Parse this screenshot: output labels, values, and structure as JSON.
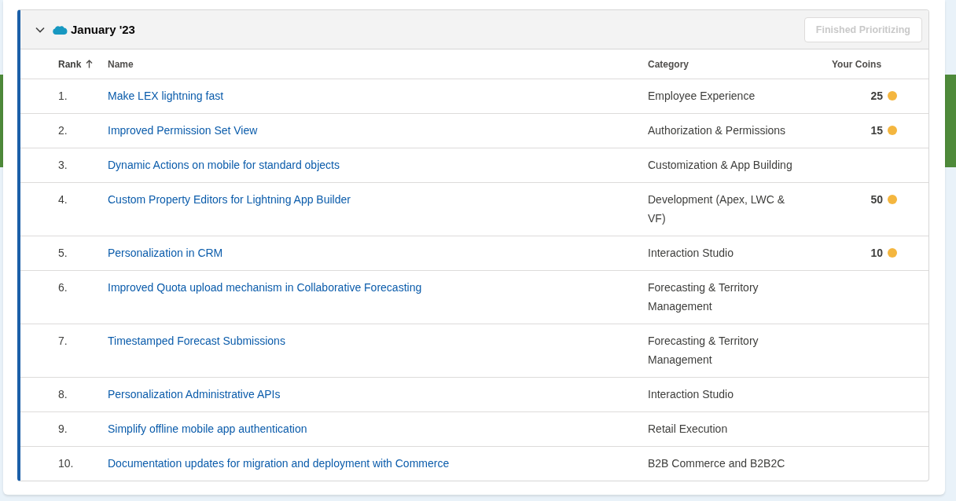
{
  "section": {
    "title": "January '23",
    "expanded": true,
    "button": {
      "label": "Finished Prioritizing",
      "disabled": true
    }
  },
  "table": {
    "columns": [
      {
        "label": "Rank",
        "sorted": true
      },
      {
        "label": "Name",
        "sorted": false
      },
      {
        "label": "Category",
        "sorted": false
      },
      {
        "label": "Your Coins",
        "sorted": false
      }
    ],
    "rows": [
      {
        "rank": "1.",
        "name": "Make LEX lightning fast",
        "category": "Employee Experience",
        "coins": "25"
      },
      {
        "rank": "2.",
        "name": "Improved Permission Set View",
        "category": "Authorization & Permissions",
        "coins": "15"
      },
      {
        "rank": "3.",
        "name": "Dynamic Actions on mobile for standard objects",
        "category": "Customization & App Building"
      },
      {
        "rank": "4.",
        "name": "Custom Property Editors for Lightning App Builder",
        "category": "Development (Apex, LWC & VF)",
        "coins": "50"
      },
      {
        "rank": "5.",
        "name": "Personalization in CRM",
        "category": "Interaction Studio",
        "coins": "10"
      },
      {
        "rank": "6.",
        "name": "Improved Quota upload mechanism in Collaborative Forecasting",
        "category": "Forecasting & Territory Management"
      },
      {
        "rank": "7.",
        "name": "Timestamped Forecast Submissions",
        "category": "Forecasting & Territory Management"
      },
      {
        "rank": "8.",
        "name": "Personalization Administrative APIs",
        "category": "Interaction Studio"
      },
      {
        "rank": "9.",
        "name": "Simplify offline mobile app authentication",
        "category": "Retail Execution"
      },
      {
        "rank": "10.",
        "name": "Documentation updates for migration and deployment with Commerce",
        "category": "B2B Commerce and B2B2C"
      }
    ]
  }
}
